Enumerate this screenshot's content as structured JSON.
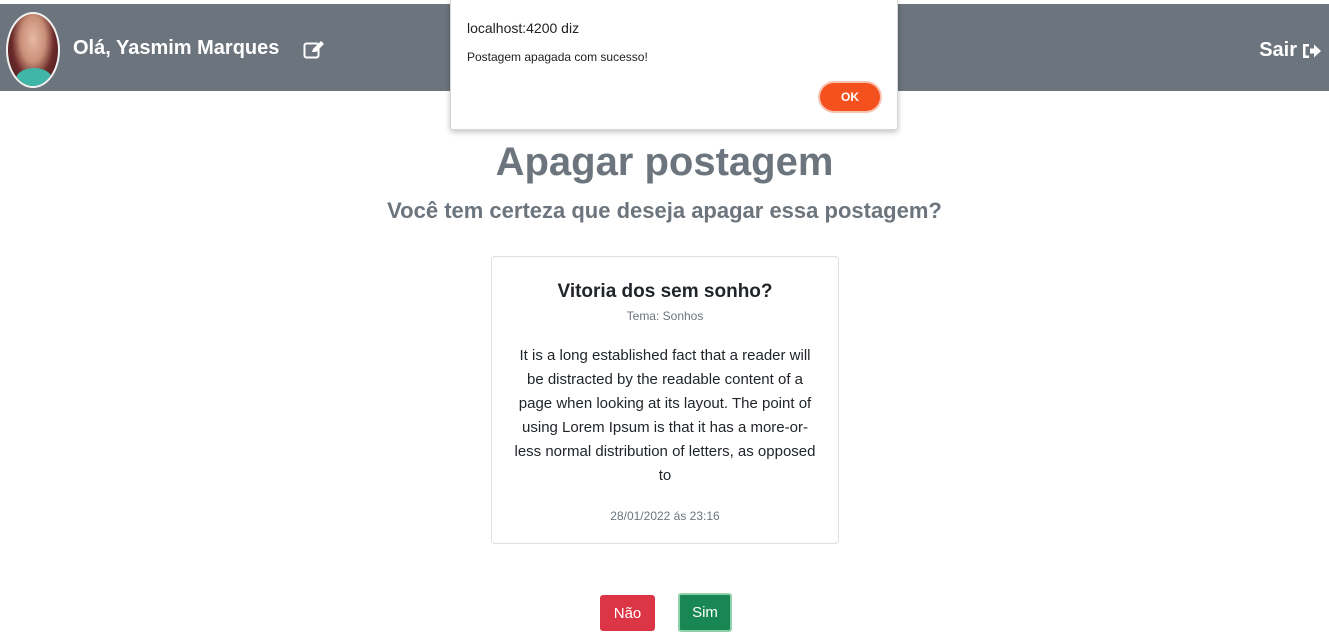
{
  "header": {
    "greeting": "Olá, Yasmim Marques",
    "logout_label": "Sair",
    "edit_icon": "edit-icon",
    "logout_icon": "sign-out-icon",
    "background_color": "#6c757d"
  },
  "main": {
    "title": "Apagar postagem",
    "subtitle": "Você tem certeza que deseja apagar essa postagem?"
  },
  "post": {
    "title": "Vitoria dos sem sonho?",
    "theme": "Tema: Sonhos",
    "text": "It is a long established fact that a reader will be distracted by the readable content of a page when looking at its layout. The point of using Lorem Ipsum is that it has a more-or-less normal distribution of letters, as opposed to",
    "date": "28/01/2022 ás 23:16"
  },
  "actions": {
    "no_label": "Não",
    "yes_label": "Sim",
    "no_color": "#dc3545",
    "yes_color": "#198754"
  },
  "alert_dialog": {
    "origin": "localhost:4200 diz",
    "message": "Postagem apagada com sucesso!",
    "ok_label": "OK",
    "ok_color": "#f4511e"
  }
}
